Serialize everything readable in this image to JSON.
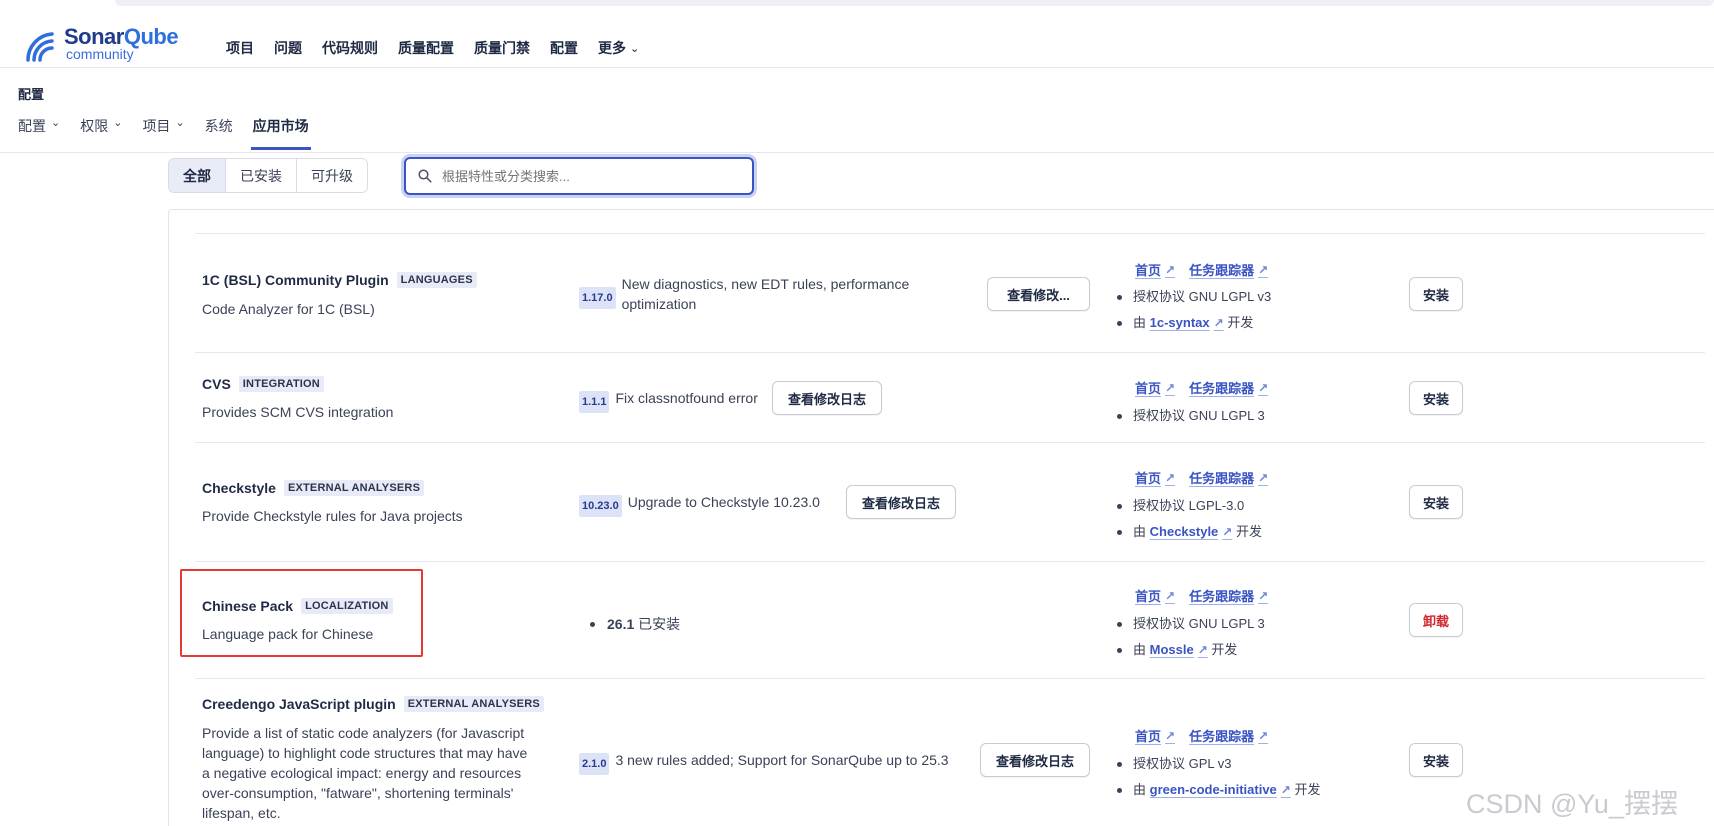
{
  "brand": {
    "name_part1": "Sonar",
    "name_part2": "Qube",
    "edition": "community"
  },
  "nav": {
    "items": [
      "项目",
      "问题",
      "代码规则",
      "质量配置",
      "质量门禁",
      "配置"
    ],
    "more": "更多"
  },
  "page_title": "配置",
  "subnav": {
    "tabs": [
      {
        "label": "配置",
        "dropdown": true
      },
      {
        "label": "权限",
        "dropdown": true
      },
      {
        "label": "项目",
        "dropdown": true
      },
      {
        "label": "系统",
        "dropdown": false
      },
      {
        "label": "应用市场",
        "dropdown": false,
        "active": true
      }
    ]
  },
  "filter": {
    "all": "全部",
    "installed": "已安装",
    "updates": "可升级"
  },
  "search": {
    "placeholder": "根据特性或分类搜索..."
  },
  "plugins": [
    {
      "name": "1C (BSL) Community Plugin",
      "category": "LANGUAGES",
      "description": "Code Analyzer for 1C (BSL)",
      "version": "1.17.0",
      "version_note": "New diagnostics, new EDT rules, performance optimization",
      "changelog": "查看修改...",
      "homepage": "首页",
      "tracker": "任务跟踪器",
      "license": "授权协议 GNU LGPL v3",
      "dev_prefix": "由",
      "developer": "1c-syntax",
      "dev_suffix": "开发",
      "action": "安装"
    },
    {
      "name": "CVS",
      "category": "INTEGRATION",
      "description": "Provides SCM CVS integration",
      "version": "1.1.1",
      "version_note": "Fix classnotfound error",
      "changelog": "查看修改日志",
      "homepage": "首页",
      "tracker": "任务跟踪器",
      "license": "授权协议 GNU LGPL 3",
      "action": "安装"
    },
    {
      "name": "Checkstyle",
      "category": "EXTERNAL ANALYSERS",
      "description": "Provide Checkstyle rules for Java projects",
      "version": "10.23.0",
      "version_note": "Upgrade to Checkstyle 10.23.0",
      "changelog": "查看修改日志",
      "homepage": "首页",
      "tracker": "任务跟踪器",
      "license": "授权协议 LGPL-3.0",
      "dev_prefix": "由",
      "developer": "Checkstyle",
      "dev_suffix": "开发",
      "action": "安装"
    },
    {
      "name": "Chinese Pack",
      "category": "LOCALIZATION",
      "description": "Language pack for Chinese",
      "installed_version": "26.1",
      "installed_label": "已安装",
      "homepage": "首页",
      "tracker": "任务跟踪器",
      "license": "授权协议 GNU LGPL 3",
      "dev_prefix": "由",
      "developer": "Mossle",
      "dev_suffix": "开发",
      "action": "卸载"
    },
    {
      "name": "Creedengo JavaScript plugin",
      "category": "EXTERNAL ANALYSERS",
      "description_lines": [
        "Provide a list of static code analyzers (for Javascript",
        "language) to highlight code structures that may have",
        "a negative ecological impact: energy and resources",
        "over-consumption, \"fatware\", shortening terminals'",
        "lifespan, etc."
      ],
      "version": "2.1.0",
      "version_note": "3 new rules added; Support for SonarQube up to 25.3",
      "changelog": "查看修改日志",
      "homepage": "首页",
      "tracker": "任务跟踪器",
      "license": "授权协议 GPL v3",
      "dev_prefix": "由",
      "developer": "green-code-initiative",
      "dev_suffix": "开发",
      "action": "安装"
    }
  ],
  "watermark": "CSDN @Yu_摆摆"
}
